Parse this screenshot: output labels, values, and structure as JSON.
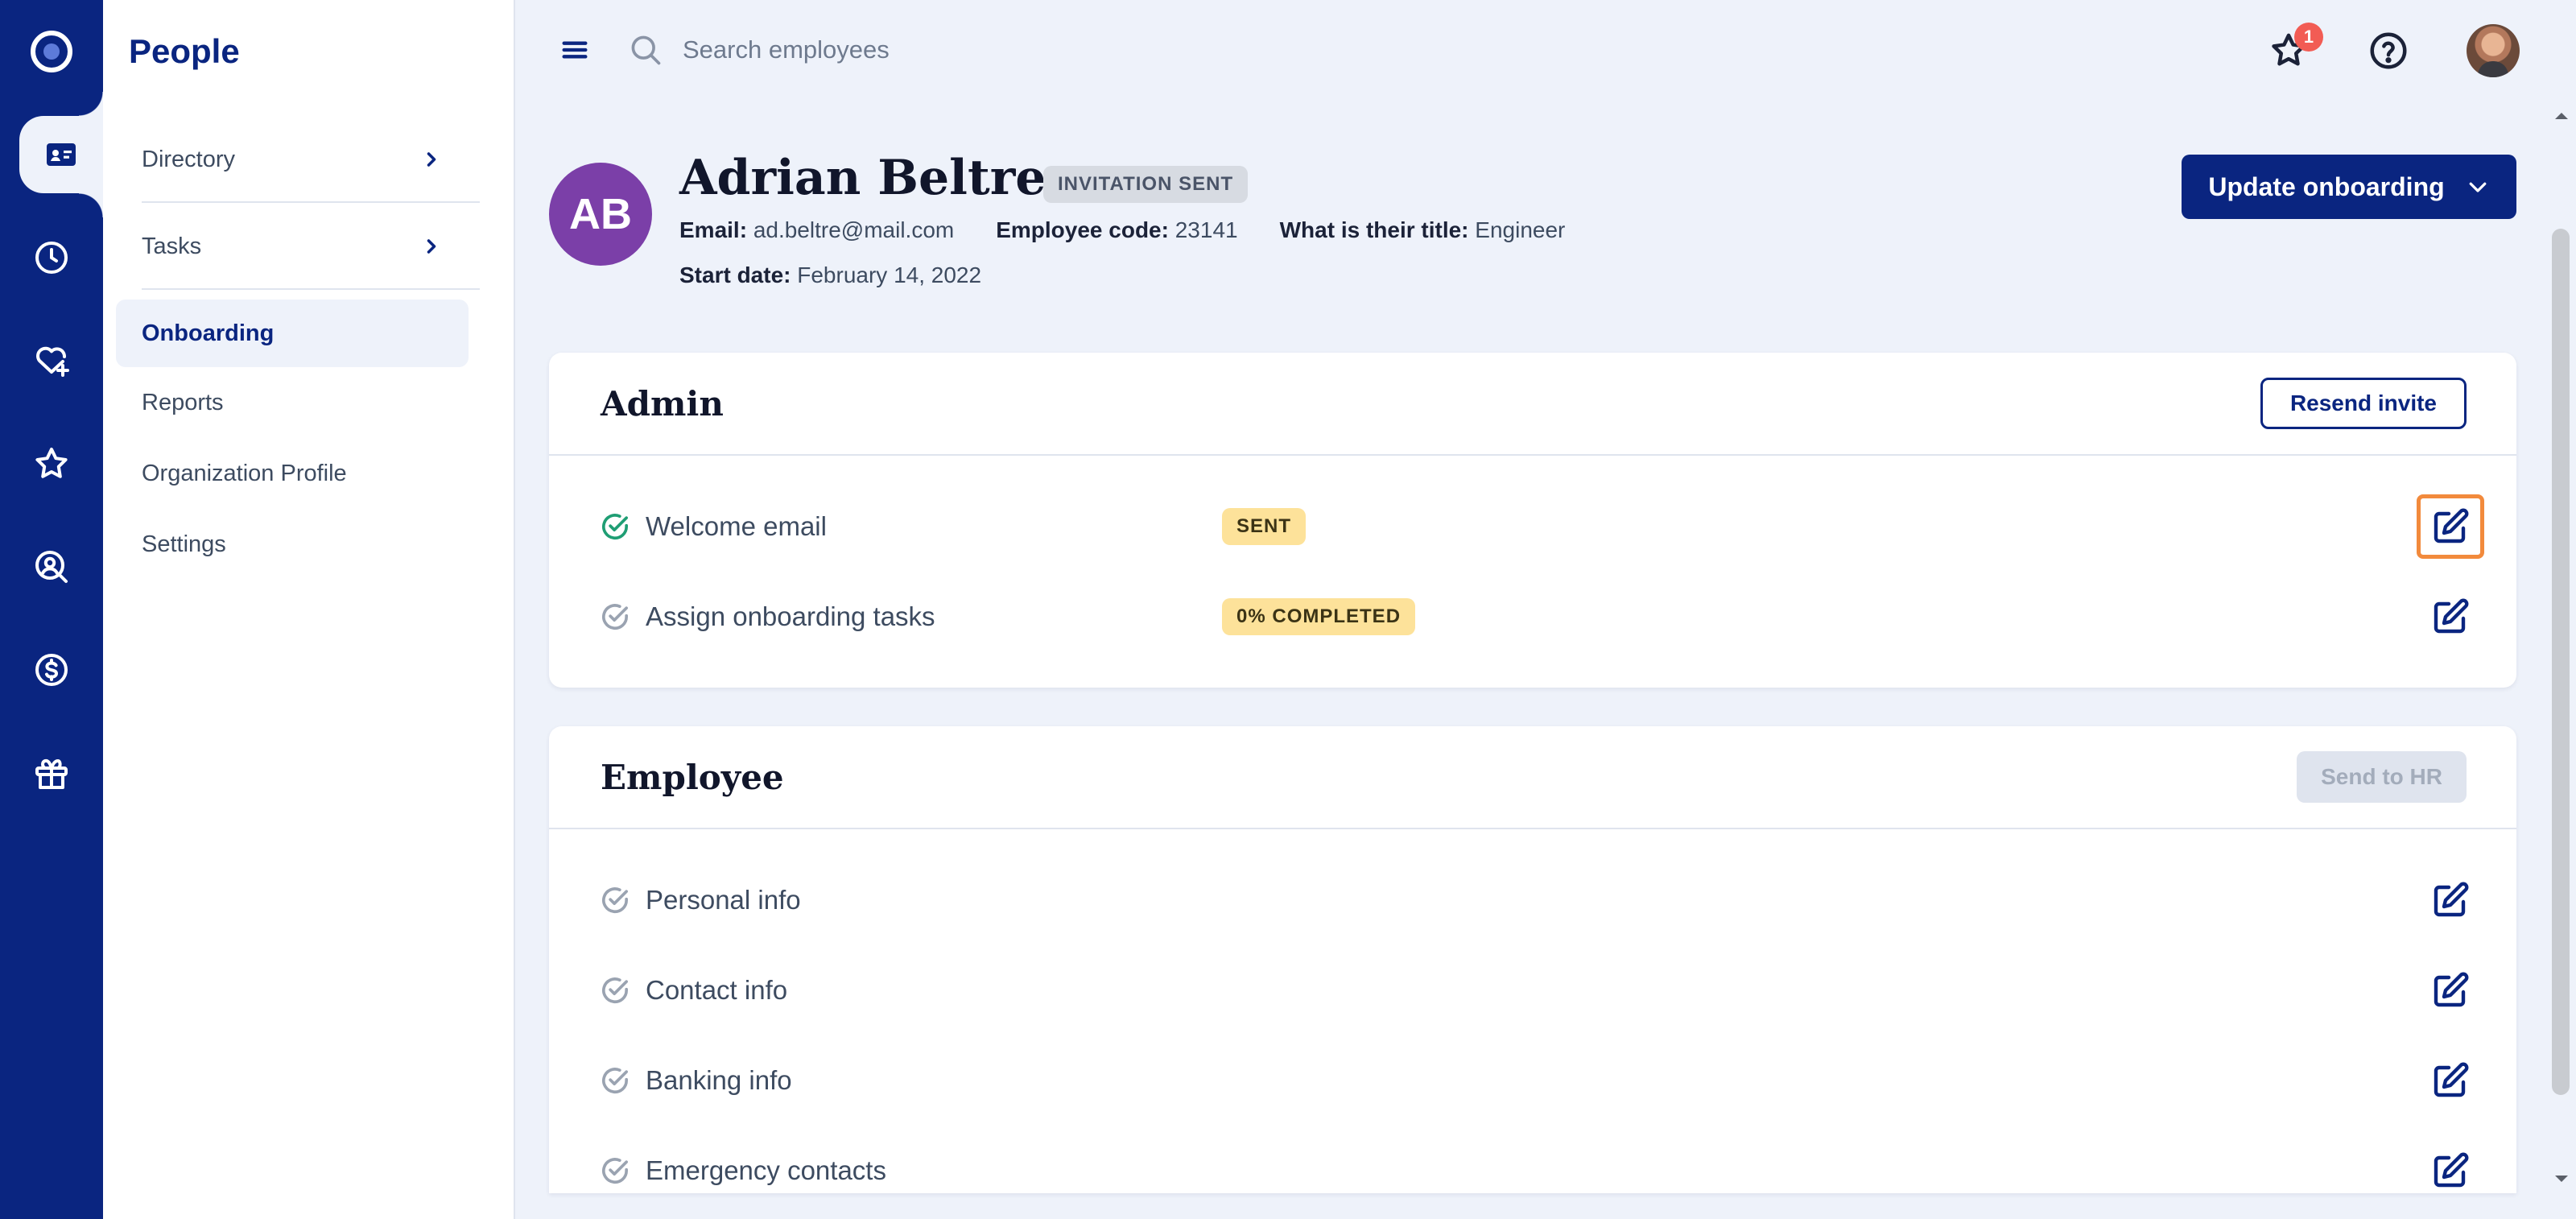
{
  "app": {
    "section_title": "People"
  },
  "rail": {
    "items": [
      {
        "icon": "logo-icon"
      },
      {
        "icon": "id-card-icon",
        "active": true
      },
      {
        "icon": "clock-icon"
      },
      {
        "icon": "heart-plus-icon"
      },
      {
        "icon": "star-icon"
      },
      {
        "icon": "user-search-icon"
      },
      {
        "icon": "dollar-circle-icon"
      },
      {
        "icon": "gift-box-icon"
      }
    ]
  },
  "sidebar": {
    "items": [
      {
        "label": "Directory",
        "has_children": true
      },
      {
        "label": "Tasks",
        "has_children": true
      },
      {
        "label": "Onboarding",
        "active": true
      },
      {
        "label": "Reports"
      },
      {
        "label": "Organization Profile"
      },
      {
        "label": "Settings"
      }
    ]
  },
  "topbar": {
    "search_placeholder": "Search employees",
    "notification_count": "1"
  },
  "profile": {
    "initials": "AB",
    "name": "Adrian Beltre",
    "status": "INVITATION SENT",
    "email_label": "Email:",
    "email": "ad.beltre@mail.com",
    "code_label": "Employee code:",
    "code": "23141",
    "title_label": "What is their title:",
    "title": "Engineer",
    "start_label": "Start date:",
    "start_date": "February 14, 2022",
    "update_button": "Update onboarding"
  },
  "admin_card": {
    "title": "Admin",
    "action_label": "Resend invite",
    "tasks": [
      {
        "label": "Welcome email",
        "badge": "SENT",
        "done": true
      },
      {
        "label": "Assign onboarding tasks",
        "badge": "0% COMPLETED",
        "done": false
      }
    ]
  },
  "employee_card": {
    "title": "Employee",
    "action_label": "Send to HR",
    "tasks": [
      {
        "label": "Personal info"
      },
      {
        "label": "Contact info"
      },
      {
        "label": "Banking info"
      },
      {
        "label": "Emergency contacts"
      }
    ]
  },
  "colors": {
    "brand": "#0a2580",
    "check_done": "#1f9e74",
    "check_pending": "#9aa3b1",
    "badge_bg": "#fde29a",
    "avatar_bg": "#7b3fa8",
    "focus_ring": "#f28a3c"
  }
}
